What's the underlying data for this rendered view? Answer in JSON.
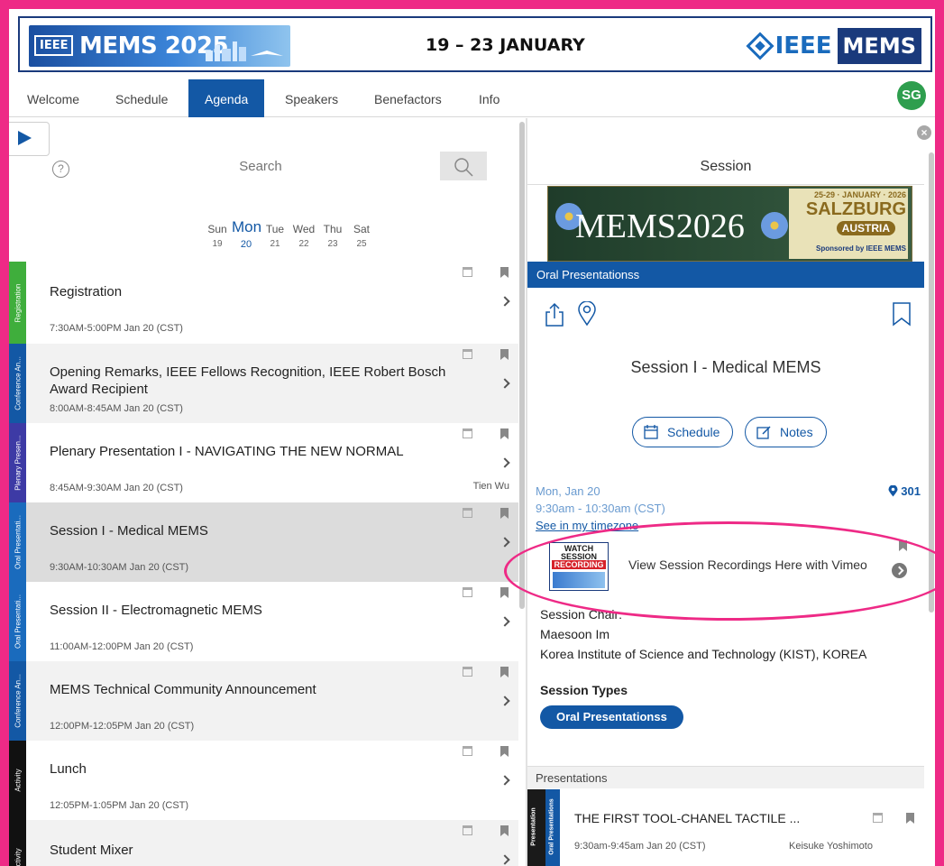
{
  "banner": {
    "ieee_small": "IEEE",
    "event_name": "MEMS 2025",
    "dates": "19 – 23 JANUARY",
    "ieee_brand": "IEEE",
    "mems_brand": "MEMS"
  },
  "nav": {
    "tabs": [
      {
        "label": "Welcome",
        "active": false
      },
      {
        "label": "Schedule",
        "active": false
      },
      {
        "label": "Agenda",
        "active": true
      },
      {
        "label": "Speakers",
        "active": false
      },
      {
        "label": "Benefactors",
        "active": false
      },
      {
        "label": "Info",
        "active": false
      }
    ],
    "avatar_initials": "SG"
  },
  "agenda": {
    "search_placeholder": "Search",
    "help_glyph": "?",
    "days": [
      {
        "name": "Sun",
        "date": "19",
        "active": false
      },
      {
        "name": "Mon",
        "date": "20",
        "active": true
      },
      {
        "name": "Tue",
        "date": "21",
        "active": false
      },
      {
        "name": "Wed",
        "date": "22",
        "active": false
      },
      {
        "name": "Thu",
        "date": "23",
        "active": false
      },
      {
        "name": "Sat",
        "date": "25",
        "active": false
      }
    ],
    "items": [
      {
        "title": "Registration",
        "time": "7:30AM-5:00PM Jan 20 (CST)",
        "category": "Registration",
        "color": "#3fae3c",
        "speaker": ""
      },
      {
        "title": "Opening Remarks, IEEE Fellows Recognition, IEEE Robert Bosch Award Recipient",
        "time": "8:00AM-8:45AM Jan 20 (CST)",
        "category": "Conference An...",
        "color": "#1358a5",
        "speaker": ""
      },
      {
        "title": "Plenary Presentation I - NAVIGATING THE NEW NORMAL",
        "time": "8:45AM-9:30AM Jan 20 (CST)",
        "category": "Plenary Presen...",
        "color": "#3d3aa5",
        "speaker": "Tien Wu"
      },
      {
        "title": "Session I - Medical MEMS",
        "time": "9:30AM-10:30AM Jan 20 (CST)",
        "category": "Oral Presentati...",
        "color": "#1a6bbd",
        "speaker": "",
        "selected": true
      },
      {
        "title": "Session II - Electromagnetic MEMS",
        "time": "11:00AM-12:00PM Jan 20 (CST)",
        "category": "Oral Presentati...",
        "color": "#1a6bbd",
        "speaker": ""
      },
      {
        "title": "MEMS Technical Community Announcement",
        "time": "12:00PM-12:05PM Jan 20 (CST)",
        "category": "Conference An...",
        "color": "#1358a5",
        "speaker": ""
      },
      {
        "title": "Lunch",
        "time": "12:05PM-1:05PM Jan 20 (CST)",
        "category": "Activity",
        "color": "#111111",
        "speaker": ""
      },
      {
        "title": "Student Mixer",
        "time": "",
        "category": "Activity",
        "color": "#111111",
        "speaker": ""
      }
    ]
  },
  "session": {
    "header": "Session",
    "ad": {
      "event": "MEMS2026",
      "dates": "25-29 · JANUARY · 2026",
      "city": "SALZBURG",
      "country": "AUSTRIA",
      "sponsor": "Sponsored by IEEE MEMS"
    },
    "type_bar": "Oral Presentationss",
    "title": "Session I - Medical MEMS",
    "schedule_label": "Schedule",
    "notes_label": "Notes",
    "date": "Mon, Jan 20",
    "room": "301",
    "time_range": "9:30am - 10:30am (CST)",
    "timezone_link": "See in my timezone",
    "recording_thumb": {
      "line1": "WATCH",
      "line2": "SESSION",
      "line3": "RECORDING"
    },
    "recording_label": "View Session Recordings Here with Vimeo",
    "chair_label": "Session Chair:",
    "chair_name": "Maesoon Im",
    "chair_org": "Korea Institute of Science and Technology (KIST), KOREA",
    "types_label": "Session Types",
    "type_pill": "Oral Presentationss",
    "presentations_label": "Presentations",
    "presentation": {
      "strip_a": "Presentation",
      "strip_b": "Oral Presentations",
      "title": "THE FIRST TOOL-CHANEL TACTILE ...",
      "time": "9:30am-9:45am Jan 20 (CST)",
      "speaker": "Keisuke Yoshimoto"
    }
  },
  "colors": {
    "frame": "#ee2a86",
    "brand_blue": "#1358a5",
    "avatar_green": "#2e9e4e"
  }
}
